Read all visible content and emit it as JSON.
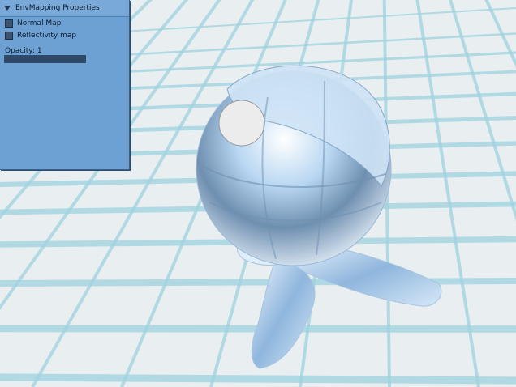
{
  "panel": {
    "title": "EnvMapping Properties",
    "options": [
      {
        "label": "Normal Map",
        "checked": true
      },
      {
        "label": "Reflectivity map",
        "checked": true
      }
    ],
    "opacity_label": "Opacity: 1",
    "opacity_value": 1
  },
  "scene": {
    "floor_color": "#e9eef0",
    "grid_color": "#9fd3df",
    "shader_ball_color": "#c9dcef"
  }
}
